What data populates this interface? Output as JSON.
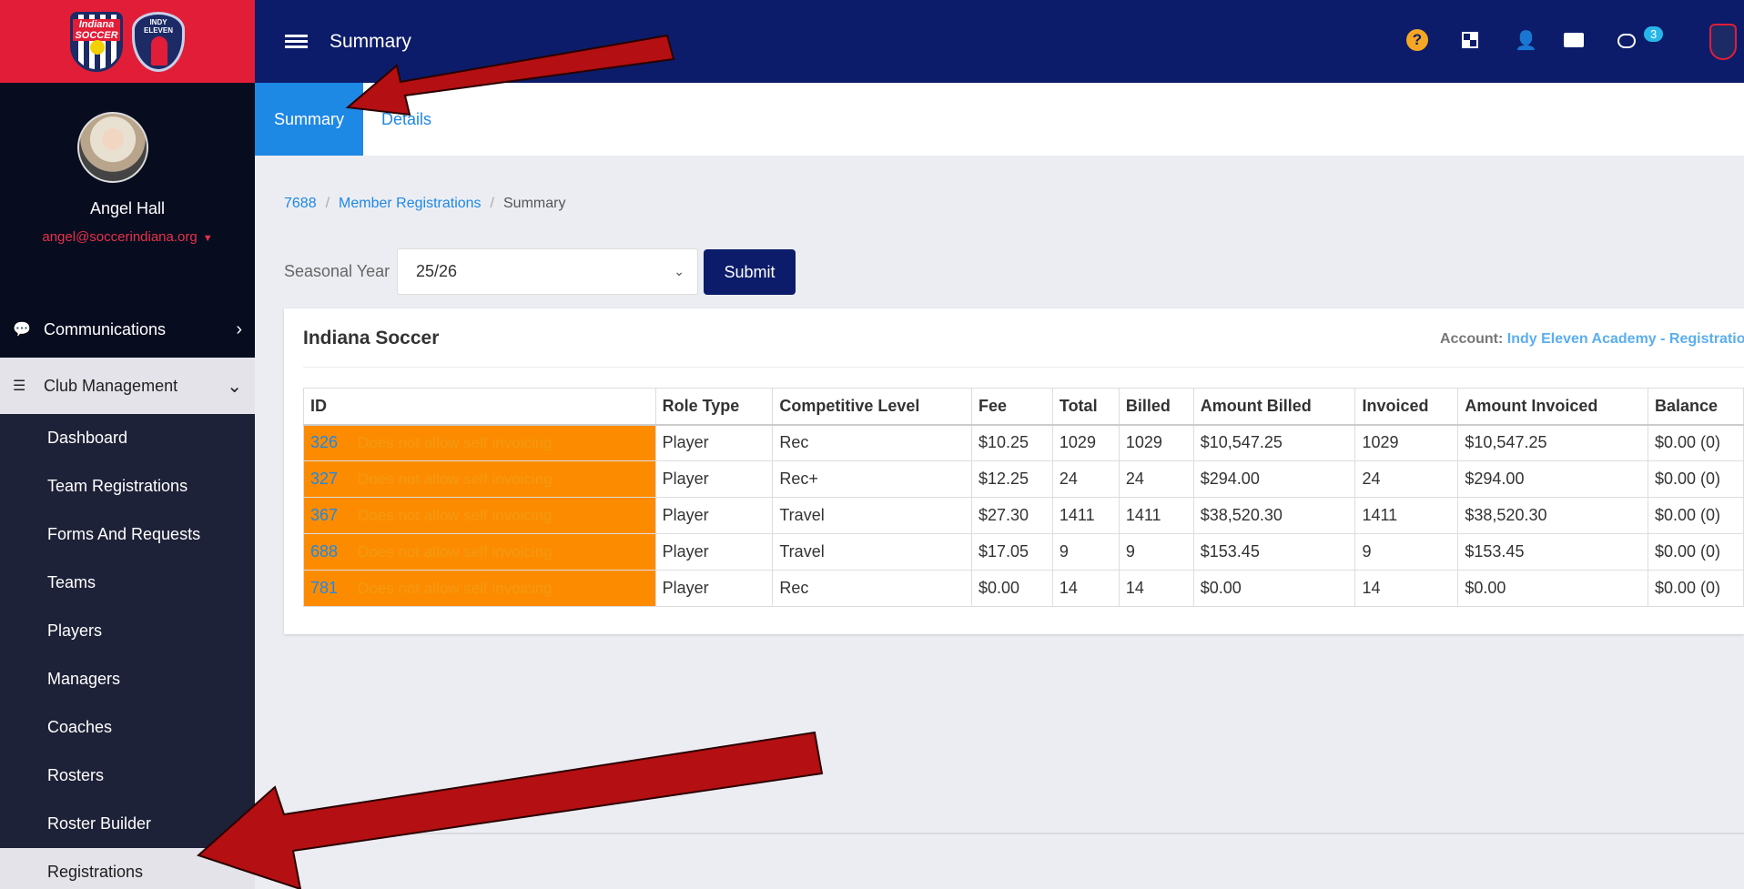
{
  "header": {
    "title": "Summary",
    "notification_count": "3"
  },
  "logos": {
    "indiana": "Indiana SOCCER",
    "indy": "INDY ELEVEN"
  },
  "user": {
    "name": "Angel Hall",
    "email": "angel@soccerindiana.org"
  },
  "sidebar": {
    "communications": "Communications",
    "club_management": "Club Management",
    "items": [
      {
        "label": "Dashboard"
      },
      {
        "label": "Team Registrations"
      },
      {
        "label": "Forms And Requests"
      },
      {
        "label": "Teams"
      },
      {
        "label": "Players"
      },
      {
        "label": "Managers"
      },
      {
        "label": "Coaches"
      },
      {
        "label": "Rosters"
      },
      {
        "label": "Roster Builder"
      },
      {
        "label": "Registrations"
      }
    ]
  },
  "tabs": {
    "summary": "Summary",
    "details": "Details"
  },
  "breadcrumb": {
    "home": "7688",
    "parent": "Member Registrations",
    "current": "Summary"
  },
  "filter": {
    "label": "Seasonal Year",
    "value": "25/26",
    "submit": "Submit"
  },
  "card": {
    "title": "Indiana Soccer",
    "account_label": "Account:",
    "account_value": "Indy Eleven Academy - Registration"
  },
  "table": {
    "headers": [
      "ID",
      "Role Type",
      "Competitive Level",
      "Fee",
      "Total",
      "Billed",
      "Amount Billed",
      "Invoiced",
      "Amount Invoiced",
      "Balance"
    ],
    "rows": [
      {
        "id": "326",
        "note": "Does not allow self invoicing",
        "role": "Player",
        "level": "Rec",
        "fee": "$10.25",
        "total": "1029",
        "billed": "1029",
        "amount_billed": "$10,547.25",
        "invoiced": "1029",
        "amount_invoiced": "$10,547.25",
        "balance": "$0.00 (0)"
      },
      {
        "id": "327",
        "note": "Does not allow self invoicing",
        "role": "Player",
        "level": "Rec+",
        "fee": "$12.25",
        "total": "24",
        "billed": "24",
        "amount_billed": "$294.00",
        "invoiced": "24",
        "amount_invoiced": "$294.00",
        "balance": "$0.00 (0)"
      },
      {
        "id": "367",
        "note": "Does not allow self invoicing",
        "role": "Player",
        "level": "Travel",
        "fee": "$27.30",
        "total": "1411",
        "billed": "1411",
        "amount_billed": "$38,520.30",
        "invoiced": "1411",
        "amount_invoiced": "$38,520.30",
        "balance": "$0.00 (0)"
      },
      {
        "id": "688",
        "note": "Does not allow self invoicing",
        "role": "Player",
        "level": "Travel",
        "fee": "$17.05",
        "total": "9",
        "billed": "9",
        "amount_billed": "$153.45",
        "invoiced": "9",
        "amount_invoiced": "$153.45",
        "balance": "$0.00 (0)"
      },
      {
        "id": "781",
        "note": "Does not allow self invoicing",
        "role": "Player",
        "level": "Rec",
        "fee": "$0.00",
        "total": "14",
        "billed": "14",
        "amount_billed": "$0.00",
        "invoiced": "14",
        "amount_invoiced": "$0.00",
        "balance": "$0.00 (0)"
      }
    ]
  },
  "colors": {
    "brand_red": "#e21d38",
    "navy": "#0c1c6a",
    "accent_blue": "#1e88e5",
    "warning_orange": "#fd8b00",
    "arrow_red": "#b40f12"
  }
}
